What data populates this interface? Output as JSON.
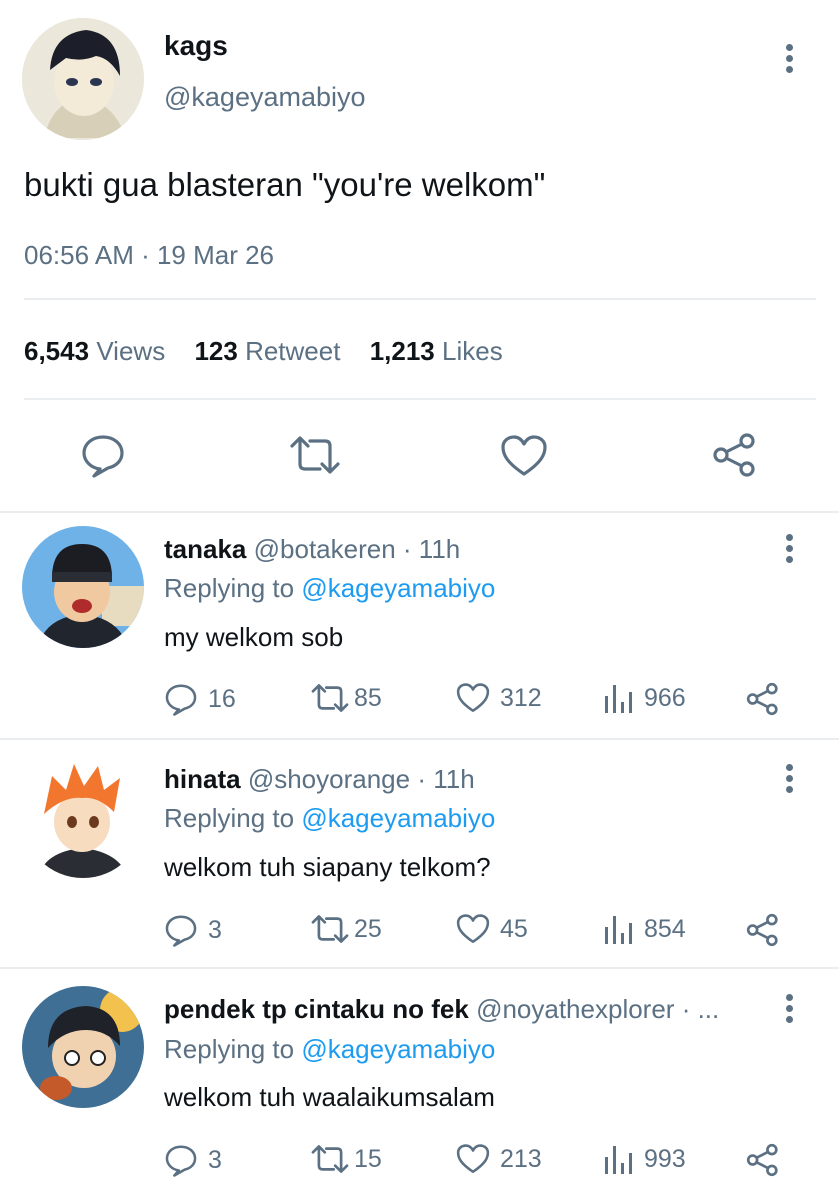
{
  "main_tweet": {
    "name": "kags",
    "handle": "@kageyamabiyo",
    "text": "bukti gua blasteran \"you're welkom\"",
    "timestamp": "06:56 AM · 19 Mar 26",
    "stats": {
      "views_count": "6,543",
      "views_label": "Views",
      "retweets_count": "123",
      "retweets_label": "Retweet",
      "likes_count": "1,213",
      "likes_label": "Likes"
    }
  },
  "replies": [
    {
      "name": "tanaka",
      "handle": "@botakeren",
      "time": "· 11h",
      "replying_label": "Replying to",
      "replying_handle": "@kageyamabiyo",
      "text": "my welkom sob",
      "replies": "16",
      "retweets": "85",
      "likes": "312",
      "views": "966"
    },
    {
      "name": "hinata",
      "handle": "@shoyorange",
      "time": "· 11h",
      "replying_label": "Replying to",
      "replying_handle": "@kageyamabiyo",
      "text": "welkom tuh siapany telkom?",
      "replies": "3",
      "retweets": "25",
      "likes": "45",
      "views": "854"
    },
    {
      "name": "pendek tp cintaku no fek",
      "handle": "@noyathexplorer",
      "time": "· ...",
      "replying_label": "Replying to",
      "replying_handle": "@kageyamabiyo",
      "text": "welkom tuh waalaikumsalam",
      "replies": "3",
      "retweets": "15",
      "likes": "213",
      "views": "993"
    }
  ],
  "icons": {
    "reply": "speech-bubble-icon",
    "retweet": "retweet-arrows-icon",
    "like": "heart-icon",
    "views": "bar-chart-icon",
    "share": "share-nodes-icon",
    "more": "vertical-ellipsis-icon"
  },
  "colors": {
    "text": "#0f1419",
    "muted": "#5b7083",
    "link": "#1d9bf0",
    "divider": "#eaeef1"
  }
}
